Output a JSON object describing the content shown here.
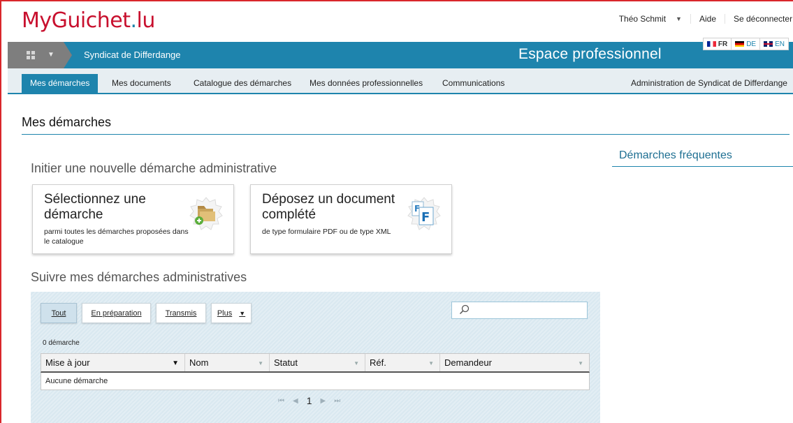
{
  "header": {
    "logo_main": "MyGuichet",
    "logo_dot": ".",
    "logo_tld": "lu",
    "user_name": "Théo Schmit",
    "help": "Aide",
    "logout": "Se déconnecter"
  },
  "bar": {
    "org_name": "Syndicat de Differdange",
    "space_title": "Espace professionnel",
    "languages": [
      {
        "code": "FR",
        "active": true
      },
      {
        "code": "DE",
        "active": false
      },
      {
        "code": "EN",
        "active": false
      }
    ]
  },
  "nav": {
    "items": [
      {
        "label": "Mes démarches",
        "active": true
      },
      {
        "label": "Mes documents"
      },
      {
        "label": "Catalogue des démarches"
      },
      {
        "label": "Mes données professionnelles"
      },
      {
        "label": "Communications"
      }
    ],
    "admin": "Administration de Syndicat de Differdange"
  },
  "page": {
    "title": "Mes démarches",
    "new_section_title": "Initier une nouvelle démarche administrative",
    "follow_section_title": "Suivre mes démarches administratives",
    "frequent_title": "Démarches fréquentes"
  },
  "cards": [
    {
      "title": "Sélectionnez une démarche",
      "description": "parmi toutes les démarches proposées dans le catalogue",
      "icon": "folder-add-icon"
    },
    {
      "title": "Déposez un document complété",
      "description": "de type formulaire PDF ou de type XML",
      "icon": "document-upload-icon"
    }
  ],
  "filters": {
    "all": "Tout",
    "draft": "En préparation",
    "sent": "Transmis",
    "more": "Plus",
    "search_placeholder": ""
  },
  "table": {
    "count": "0 démarche",
    "columns": [
      "Mise à jour",
      "Nom",
      "Statut",
      "Réf.",
      "Demandeur"
    ],
    "empty": "Aucune démarche"
  },
  "pagination": {
    "current_page": "1"
  },
  "colors": {
    "brand_red": "#c8102e",
    "brand_blue": "#1e84ad"
  }
}
